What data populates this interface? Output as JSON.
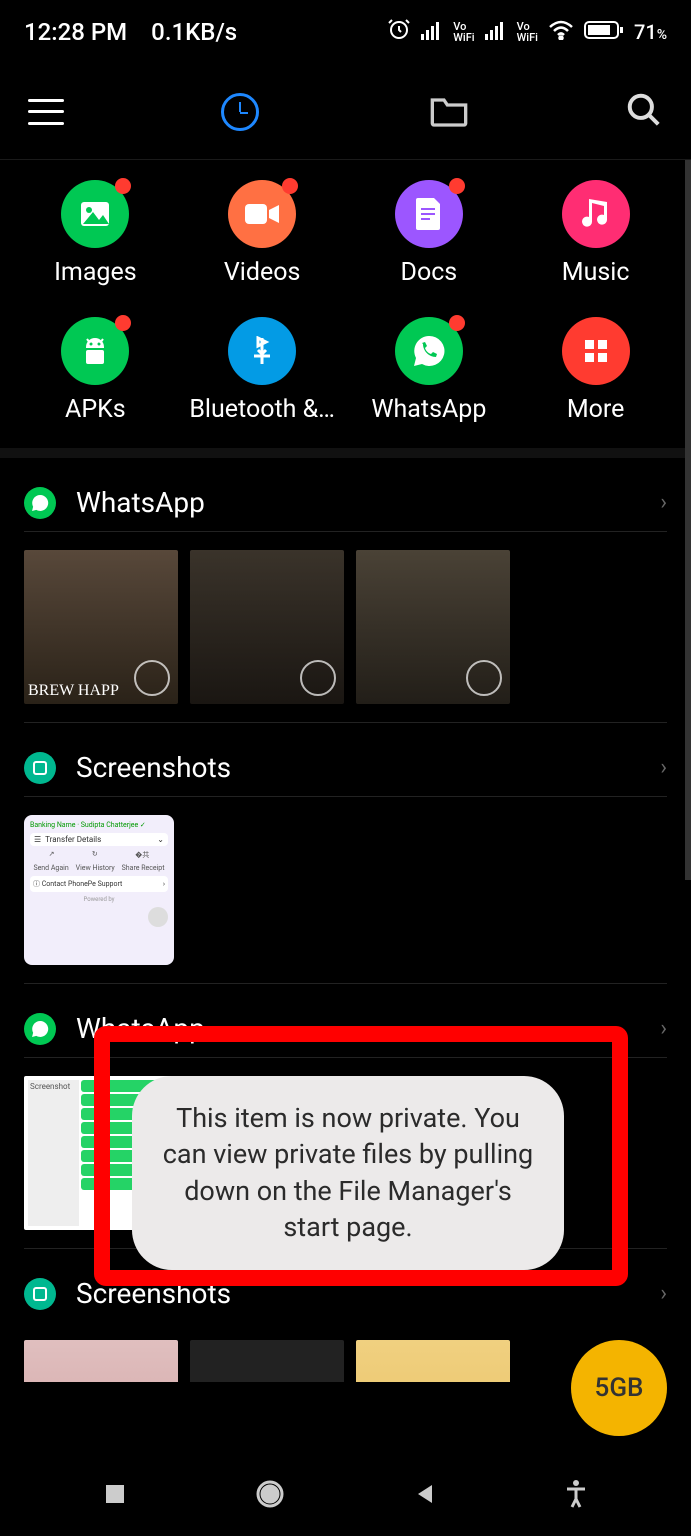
{
  "status": {
    "time": "12:28 PM",
    "speed": "0.1KB/s",
    "battery": "71",
    "battery_pct_suffix": "%"
  },
  "categories": [
    {
      "label": "Images",
      "color": "#00c853",
      "dot": true
    },
    {
      "label": "Videos",
      "color": "#ff7043",
      "dot": true
    },
    {
      "label": "Docs",
      "color": "#9c56ff",
      "dot": true
    },
    {
      "label": "Music",
      "color": "#ff2d73",
      "dot": false
    },
    {
      "label": "APKs",
      "color": "#00c853",
      "dot": true
    },
    {
      "label": "Bluetooth &…",
      "color": "#039be5",
      "dot": false
    },
    {
      "label": "WhatsApp",
      "color": "#00c853",
      "dot": true
    },
    {
      "label": "More",
      "color": "#ff3b30",
      "dot": false
    }
  ],
  "sections": [
    {
      "title": "WhatsApp",
      "badge_color": "#00c853"
    },
    {
      "title": "Screenshots",
      "badge_color": "#00b890"
    },
    {
      "title": "WhatsApp",
      "badge_color": "#00c853"
    },
    {
      "title": "Screenshots",
      "badge_color": "#00b890"
    }
  ],
  "screenshot_card": {
    "line1": "Transfer Details",
    "btns": [
      "Send Again",
      "View History",
      "Share Receipt"
    ],
    "support": "Contact PhonePe Support",
    "powered": "Powered by"
  },
  "toast": "This item is now private. You can view private files by pulling down on the File Manager's start page.",
  "fab": "5GB"
}
